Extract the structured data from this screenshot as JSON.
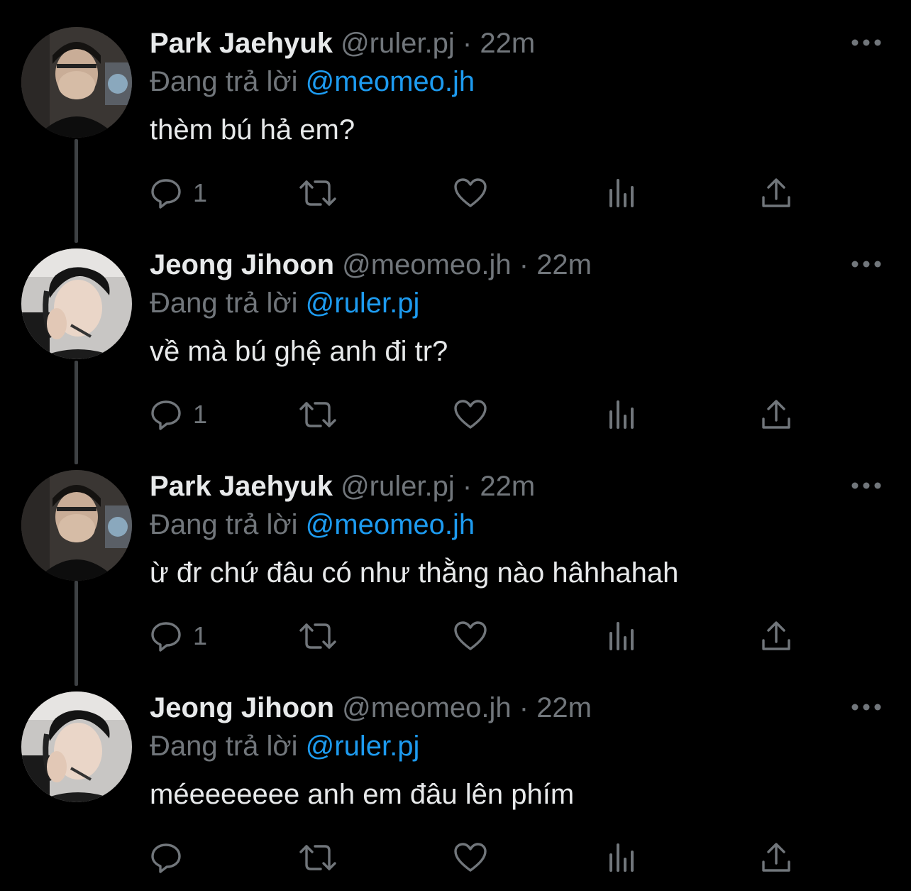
{
  "colors": {
    "background": "#000000",
    "text_primary": "#e7e9ea",
    "text_secondary": "#71767b",
    "link": "#1d9bf0",
    "thread_line": "#3e4144"
  },
  "reply_prefix": "Đang trả lời",
  "tweets": [
    {
      "name": "Park Jaehyuk",
      "handle": "@ruler.pj",
      "separator": "·",
      "time": "22m",
      "reply_to": "@meomeo.jh",
      "text": "thèm bú hả em?",
      "reply_count": "1",
      "avatar": "park-jaehyuk-avatar"
    },
    {
      "name": "Jeong Jihoon",
      "handle": "@meomeo.jh",
      "separator": "·",
      "time": "22m",
      "reply_to": "@ruler.pj",
      "text": "về mà bú ghệ anh đi tr?",
      "reply_count": "1",
      "avatar": "jeong-jihoon-avatar"
    },
    {
      "name": "Park Jaehyuk",
      "handle": "@ruler.pj",
      "separator": "·",
      "time": "22m",
      "reply_to": "@meomeo.jh",
      "text": "ừ đr chứ đâu có như thằng nào hâhhahah",
      "reply_count": "1",
      "avatar": "park-jaehyuk-avatar"
    },
    {
      "name": "Jeong Jihoon",
      "handle": "@meomeo.jh",
      "separator": "·",
      "time": "22m",
      "reply_to": "@ruler.pj",
      "text": "méeeeeeee anh em đâu lên phím",
      "reply_count": "",
      "avatar": "jeong-jihoon-avatar"
    }
  ],
  "icons": {
    "more": "more-icon",
    "reply": "reply-icon",
    "retweet": "retweet-icon",
    "like": "heart-icon",
    "views": "views-icon",
    "share": "share-icon"
  }
}
